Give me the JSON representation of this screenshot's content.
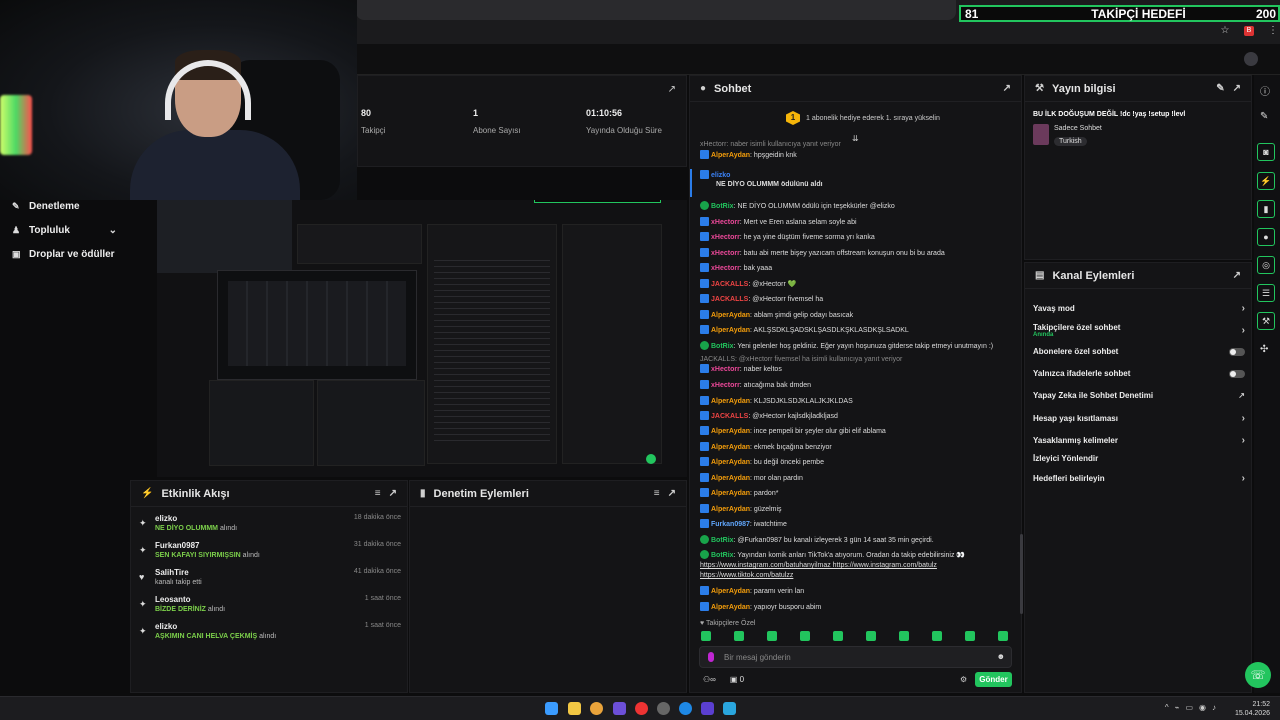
{
  "goal_bar": {
    "current": "81",
    "label": "TAKİPÇİ HEDEFİ",
    "target": "200"
  },
  "nav": {
    "items": [
      {
        "label": "Denetleme"
      },
      {
        "label": "Topluluk"
      },
      {
        "label": "Droplar ve ödüller"
      }
    ]
  },
  "stats": [
    {
      "value": "80",
      "label": "Takipçi"
    },
    {
      "value": "1",
      "label": "Abone Sayısı"
    },
    {
      "value": "01:10:56",
      "label": "Yayında Olduğu Süre"
    }
  ],
  "events": {
    "title": "Etkinlik Akışı",
    "items": [
      {
        "name": "elizko",
        "highlight": "NE DİYO OLUMMM",
        "suffix": "alındı",
        "time": "18 dakika önce"
      },
      {
        "name": "Furkan0987",
        "highlight": "SEN KAFAYI SIYIRMIŞSIN",
        "suffix": "alındı",
        "time": "31 dakika önce"
      },
      {
        "name": "SalihTire",
        "highlight": "",
        "suffix": "kanalı takip etti",
        "time": "41 dakika önce"
      },
      {
        "name": "Leosanto",
        "highlight": "BİZDE DERİNİZ",
        "suffix": "alındı",
        "time": "1 saat önce"
      },
      {
        "name": "elizko",
        "highlight": "AŞKIMIN CANI HELVA ÇEKMİŞ",
        "suffix": "alındı",
        "time": "1 saat önce"
      }
    ]
  },
  "moderation": {
    "title": "Denetim Eylemleri"
  },
  "chat": {
    "title": "Sohbet",
    "pinned": "1 abonelik hediye ederek 1. sıraya yükselin",
    "placeholder": "Bir mesaj gönderin",
    "send": "Gönder",
    "followers_only": "Takipçilere Özel",
    "points": "0",
    "messages": [
      {
        "reply": "xHectorr: naber isimli kullanıcıya yanıt veriyor"
      },
      {
        "user": "AlperAydan",
        "color": "#f59e0b",
        "text": ": hpşgeidin knk"
      },
      {
        "user": "elizko",
        "color": "#3b82f6",
        "text": ""
      },
      {
        "user": "",
        "color": "#ffffff",
        "text": "NE DİYO OLUMMM ödülünü aldı"
      },
      {
        "user": "BotRix",
        "color": "#22c55e",
        "text": ": NE DİYO OLUMMM ödülü için teşekkürler @elizko"
      },
      {
        "user": "xHectorr",
        "color": "#ec4899",
        "text": ": Mert ve Eren aslana selam soyle abi"
      },
      {
        "user": "xHectorr",
        "color": "#ec4899",
        "text": ": he ya yine düştüm fiveme sorma yrı kanka"
      },
      {
        "user": "xHectorr",
        "color": "#ec4899",
        "text": ": batu abi merte bişey yazıcam offstream konuşun onu bi bu arada"
      },
      {
        "user": "xHectorr",
        "color": "#ec4899",
        "text": ": bak yaaa"
      },
      {
        "user": "JACKALLS",
        "color": "#ef4444",
        "text": ": @xHectorr 💚"
      },
      {
        "user": "JACKALLS",
        "color": "#ef4444",
        "text": ": @xHectorr fivemsel ha"
      },
      {
        "user": "AlperAydan",
        "color": "#f59e0b",
        "text": ": ablam şimdi gelip odayı basıcak"
      },
      {
        "user": "AlperAydan",
        "color": "#f59e0b",
        "text": ": AKLŞSDKLŞADSKLŞASDLKŞKLASDKŞLSADKL"
      },
      {
        "user": "BotRix",
        "color": "#22c55e",
        "text": ": Yeni gelenler hoş geldiniz. Eğer yayın hoşunuza gitderse takip etmeyi unutmayın :)"
      },
      {
        "reply": "JACKALLS: @xHectorr fivemsel ha isimli kullanıcıya yanıt veriyor"
      },
      {
        "user": "xHectorr",
        "color": "#ec4899",
        "text": ": naber keltos"
      },
      {
        "user": "xHectorr",
        "color": "#ec4899",
        "text": ": atıcağıma bak dmden"
      },
      {
        "user": "AlperAydan",
        "color": "#f59e0b",
        "text": ": KLJSDJKLSDJKLALJKJKLDAS"
      },
      {
        "user": "JACKALLS",
        "color": "#ef4444",
        "text": ": @xHectorr kajlsdkjladkljasd"
      },
      {
        "user": "AlperAydan",
        "color": "#f59e0b",
        "text": ": ince pempeli bir şeyler olur gibi elif ablama"
      },
      {
        "user": "AlperAydan",
        "color": "#f59e0b",
        "text": ": ekmek bıçağına benziyor"
      },
      {
        "user": "AlperAydan",
        "color": "#f59e0b",
        "text": ": bu değil önceki pembe"
      },
      {
        "user": "AlperAydan",
        "color": "#f59e0b",
        "text": ": mor olan pardın"
      },
      {
        "user": "AlperAydan",
        "color": "#f59e0b",
        "text": ": pardon*"
      },
      {
        "user": "AlperAydan",
        "color": "#f59e0b",
        "text": ": güzelmiş"
      },
      {
        "user": "Furkan0987",
        "color": "#60a5fa",
        "text": ": iwatchtime"
      },
      {
        "user": "BotRix",
        "color": "#22c55e",
        "text": ": @Furkan0987 bu kanalı izleyerek 3 gün 14 saat 35 min geçirdi."
      },
      {
        "user": "BotRix",
        "color": "#22c55e",
        "text": ": Yayından komik anları TikTok'a atıyorum. Oradan da takip edebilirsiniz 👀"
      },
      {
        "user": "",
        "color": "#ffffff",
        "text": "https://www.instagram.com/batuhanyilmaz https://www.instagram.com/batulz"
      },
      {
        "user": "",
        "color": "#ffffff",
        "text": "https://www.tiktok.com/batulzz"
      },
      {
        "user": "AlperAydan",
        "color": "#f59e0b",
        "text": ": paramı verin lan"
      },
      {
        "user": "AlperAydan",
        "color": "#f59e0b",
        "text": ": yapıoyr busporu abim"
      }
    ]
  },
  "stream_info": {
    "title": "Yayın bilgisi",
    "stream_title": "BU İLK DOĞUŞUM DEĞİL !dc !yaş !setup !levl",
    "category": "Sadece Sohbet",
    "tag": "Turkish"
  },
  "channel_actions": {
    "title": "Kanal Eylemleri",
    "items": [
      {
        "label": "Yavaş mod",
        "type": "arrow",
        "sub": ""
      },
      {
        "label": "Takipçilere özel sohbet",
        "type": "arrow",
        "sub": "Anında"
      },
      {
        "label": "Abonelere özel sohbet",
        "type": "toggle",
        "sub": ""
      },
      {
        "label": "Yalnızca ifadelerle sohbet",
        "type": "toggle",
        "sub": ""
      },
      {
        "label": "Yapay Zeka ile Sohbet Denetimi",
        "type": "external",
        "sub": ""
      },
      {
        "label": "Hesap yaşı kısıtlaması",
        "type": "arrow",
        "sub": ""
      },
      {
        "label": "Yasaklanmış kelimeler",
        "type": "arrow",
        "sub": ""
      },
      {
        "label": "İzleyici Yönlendir",
        "type": "none",
        "sub": ""
      },
      {
        "label": "Hedefleri belirleyin",
        "type": "arrow",
        "sub": ""
      }
    ]
  },
  "taskbar": {
    "time": "21:52",
    "date": "15.04.2026"
  },
  "colors": {
    "accent": "#22c55e",
    "bg": "#0c0c0d",
    "panel": "#141416"
  }
}
